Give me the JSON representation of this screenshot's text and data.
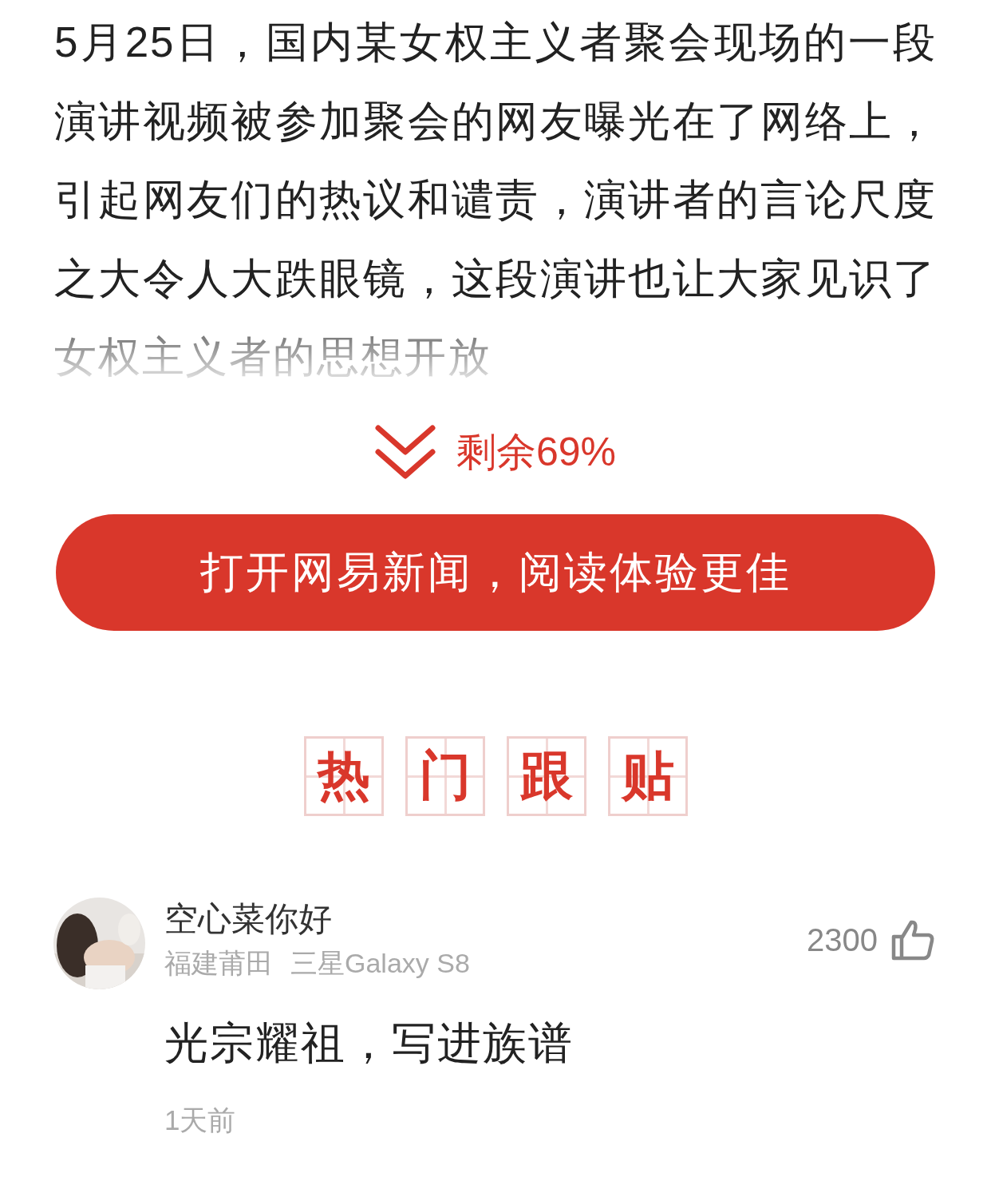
{
  "article": {
    "text": "5月25日，国内某女权主义者聚会现场的一段演讲视频被参加聚会的网友曝光在了网络上，引起网友们的热议和谴责，演讲者的言论尺度之大令人大跌眼镜，这段演讲也让大家见识了女权主义者的思想开放"
  },
  "read_more": {
    "label": "剩余69%"
  },
  "open_app_button": {
    "label": "打开网易新闻，阅读体验更佳"
  },
  "section_heading": {
    "characters": [
      "热",
      "门",
      "跟",
      "贴"
    ]
  },
  "comments": [
    {
      "user": "空心菜你好",
      "location": "福建莆田",
      "device": "三星Galaxy S8",
      "likes": "2300",
      "text": "光宗耀祖，写进族谱",
      "time": "1天前"
    }
  ]
}
